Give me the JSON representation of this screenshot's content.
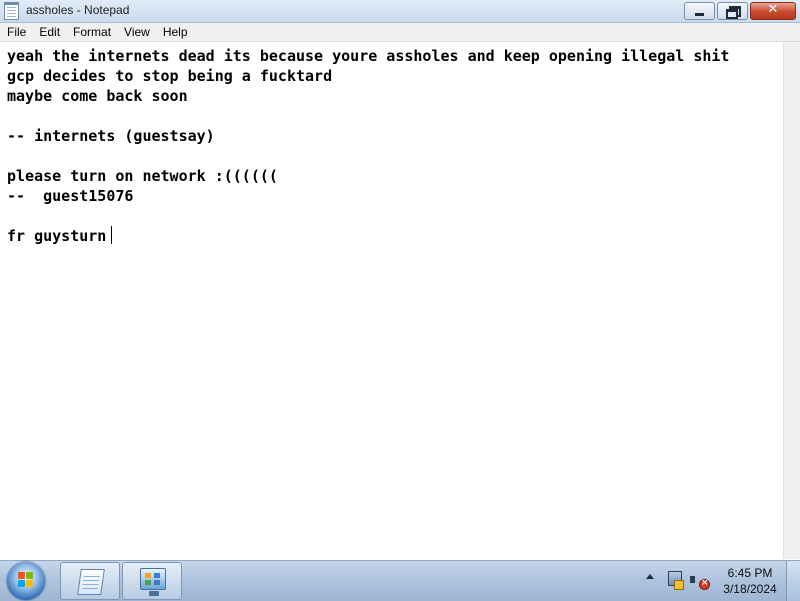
{
  "window": {
    "title": "assholes - Notepad",
    "icon": "notepad-icon",
    "controls": [
      "minimize-icon",
      "maximize-icon",
      "close-icon"
    ]
  },
  "menu": {
    "file": "File",
    "edit": "Edit",
    "format": "Format",
    "view": "View",
    "help": "Help"
  },
  "document": {
    "lines": [
      "yeah the internets dead its because youre assholes and keep opening illegal shit",
      "gcp decides to stop being a fucktard",
      "maybe come back soon",
      "",
      "-- internets (guestsay)",
      "",
      "please turn on network :((((((",
      "--  guest15076",
      "",
      "fr guysturn"
    ]
  },
  "taskbar": {
    "start_icon": "windows-start-icon",
    "pinned": [
      {
        "name": "notepad",
        "icon": "notepad-icon"
      },
      {
        "name": "control-panel",
        "icon": "control-panel-icon"
      }
    ],
    "tray": {
      "icons": [
        "show-hidden-icons-chevron",
        "network-icon",
        "volume-muted-icon"
      ],
      "time": "6:45 PM",
      "date": "3/18/2024"
    }
  },
  "colors": {
    "titlebar": "#c9daee",
    "taskbar": "#aec4de",
    "close_button": "#c74a2f",
    "editor_bg": "#ffffff",
    "text": "#000000"
  }
}
